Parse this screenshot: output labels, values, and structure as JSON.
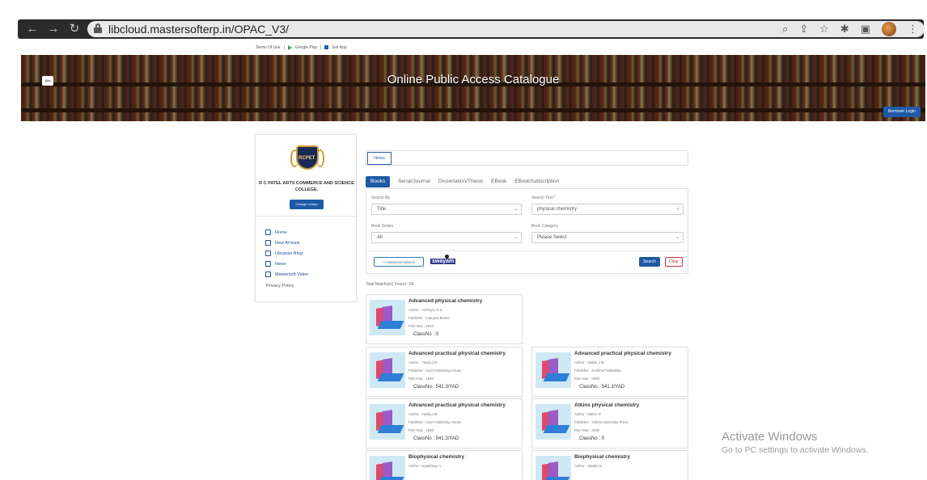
{
  "browser": {
    "url": "libcloud.mastersofterp.in/OPAC_V3/"
  },
  "top_links": [
    "Terms Of Use",
    "Google Play",
    "Get App"
  ],
  "banner": {
    "title": "Online Public Access Catalogue",
    "login_label": "Borrower Login"
  },
  "sidebar": {
    "college": "R C PATEL ARTS COMMERCE AND SCIENCE COLLEGE.",
    "change_library": "Change Library",
    "menu": [
      "Home",
      "New Arrivals",
      "Librarian Blog",
      "News",
      "Mastersoft Video"
    ],
    "privacy": "Privacy Policy"
  },
  "news_tab": "News",
  "tabs": [
    "Books",
    "Serial/Journal",
    "Dissertation/Thesis",
    "EBook",
    "EBookSubscription"
  ],
  "search": {
    "search_by_label": "Search By",
    "search_by_value": "Title",
    "search_text_label": "Search Text *",
    "search_text_value": "physical chemistry",
    "book_series_label": "Book Series",
    "book_series_value": "All",
    "book_category_label": "Book Category",
    "book_category_value": "Please Select",
    "advanced_label": "Advanced Search",
    "search_button": "Search",
    "clear_button": "Clear"
  },
  "total_matches": "Total Match(es) Found : 66",
  "results": [
    {
      "title": "Advanced physical chemistry",
      "author": "Author : Acharya, R.K.",
      "publisher": "Publisher : Campus Books",
      "year": "Pub-Year : 2013",
      "classno": "ClassNo : 0"
    },
    {
      "title": "Advanced practical physical chemistry",
      "author": "Author : Yadav,J.B.",
      "publisher": "Publisher : Goel Publishing House",
      "year": "Pub-Year : 1994",
      "classno": "ClassNo : 541.3/YAD"
    },
    {
      "title": "Advanced practical physical chemistry",
      "author": "Author : Yadav, J.B.",
      "publisher": "Publisher : Krishna Prakashan",
      "year": "Pub-Year : 2008",
      "classno": "ClassNo : 541.3/YAD"
    },
    {
      "title": "Advanced practical physical chemistry",
      "author": "Author : Yadav,J.B.",
      "publisher": "Publisher : Goel Publishing House",
      "year": "Pub-Year : 1993",
      "classno": "ClassNo : 541.3/YAD"
    },
    {
      "title": "Atkins physical chemistry",
      "author": "Author : Atkins, P.",
      "publisher": "Publisher : Oxford University Press",
      "year": "Pub-Year : 2006",
      "classno": "ClassNo : 0"
    },
    {
      "title": "Biophysical chemistry",
      "author": "Author : Upadhyay, A."
    },
    {
      "title": "Biophysical chemistry",
      "author": "Author : Satake,N."
    }
  ],
  "watermark": {
    "line1": "Activate Windows",
    "line2": "Go to PC settings to activate Windows."
  }
}
